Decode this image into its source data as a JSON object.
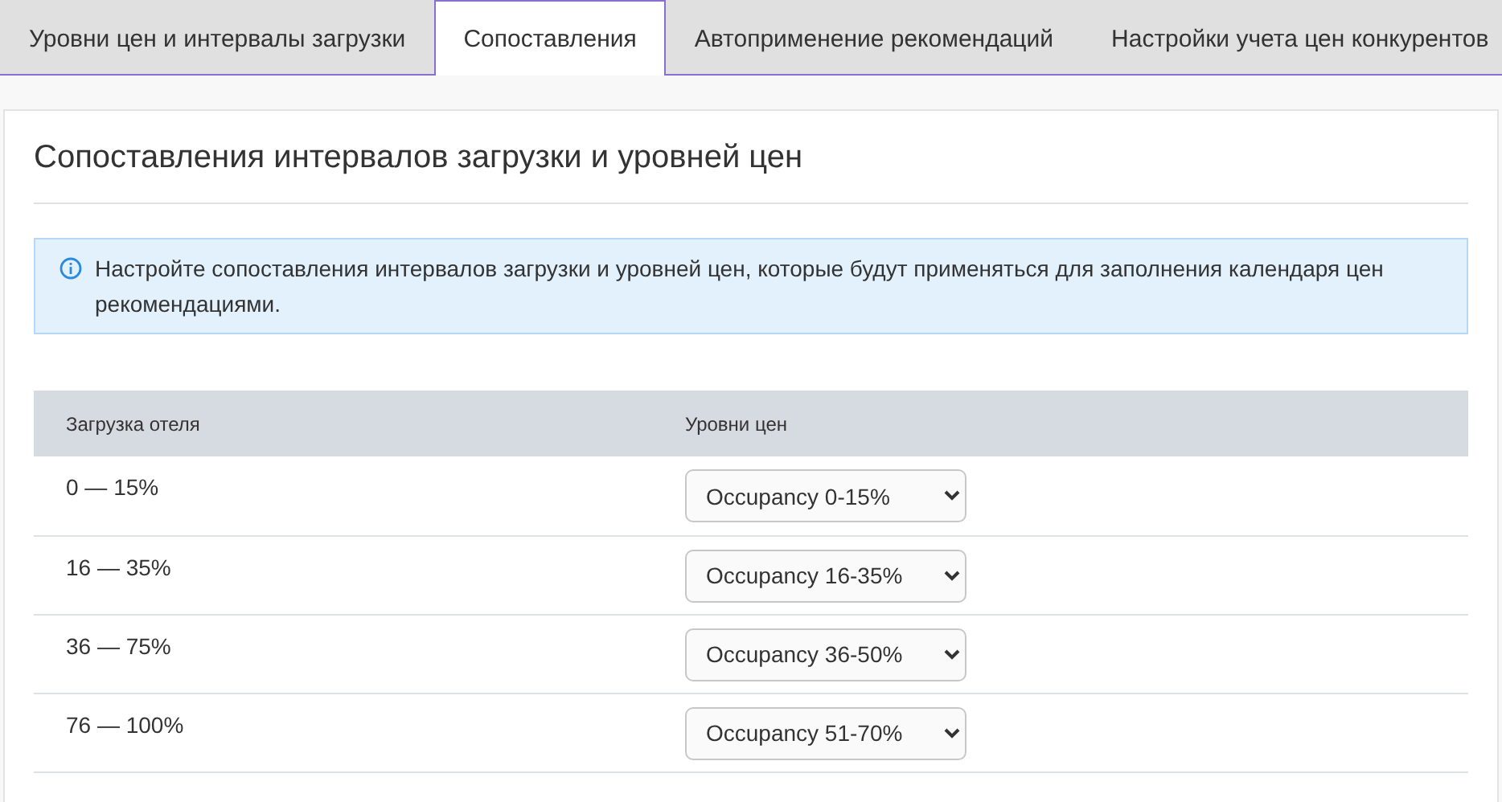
{
  "tabs": [
    {
      "label": "Уровни цен и интервалы загрузки",
      "selected": false
    },
    {
      "label": "Сопоставления",
      "selected": true
    },
    {
      "label": "Автоприменение рекомендаций",
      "selected": false
    },
    {
      "label": "Настройки учета цен конкурентов",
      "selected": false
    }
  ],
  "heading": "Сопоставления интервалов загрузки и уровней цен",
  "info": "Настройте сопоставления интервалов загрузки и уровней цен, которые будут применяться для заполнения календаря цен рекомендациями.",
  "table": {
    "columns": [
      "Загрузка отеля",
      "Уровни цен"
    ],
    "rows": [
      {
        "range": "0 — 15%",
        "level": "Occupancy 0-15%"
      },
      {
        "range": "16 — 35%",
        "level": "Occupancy 16-35%"
      },
      {
        "range": "36 — 75%",
        "level": "Occupancy 36-50%"
      },
      {
        "range": "76 — 100%",
        "level": "Occupancy 51-70%"
      }
    ]
  }
}
